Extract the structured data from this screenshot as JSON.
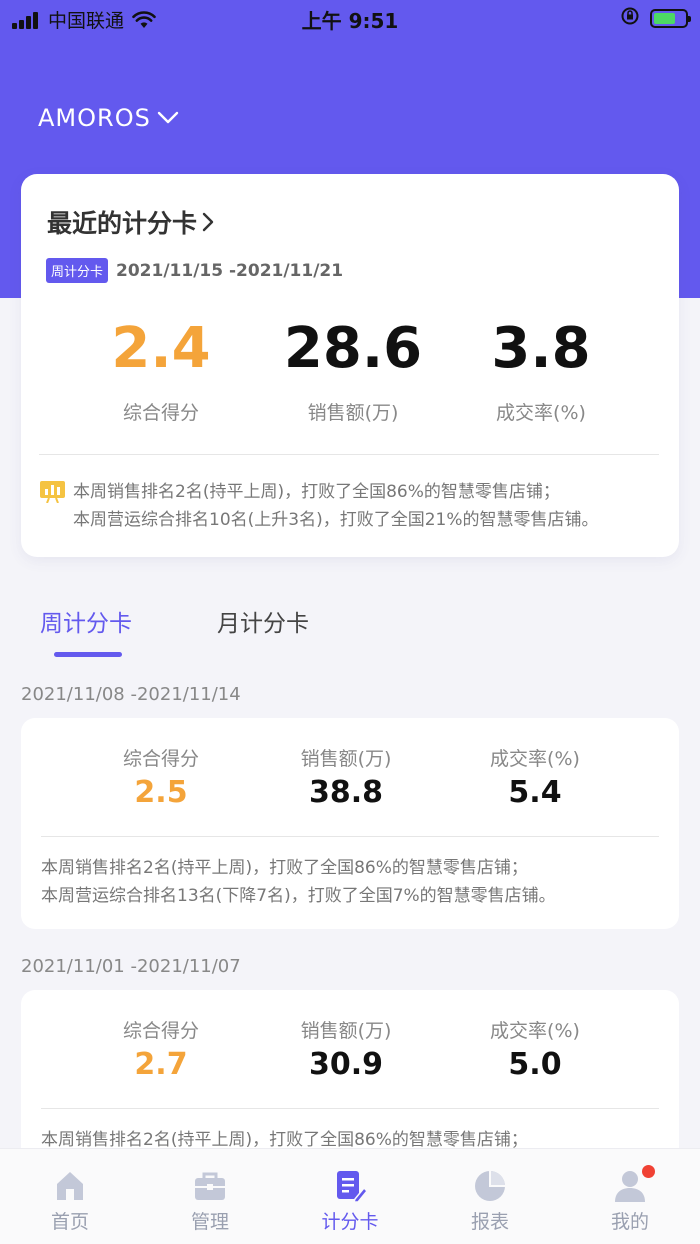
{
  "status_bar": {
    "carrier": "中国联通",
    "time": "上午 9:51"
  },
  "header": {
    "store_name": "AMOROS"
  },
  "recent_card": {
    "title": "最近的计分卡",
    "badge": "周计分卡",
    "date_range": "2021/11/15 -2021/11/21",
    "metrics": [
      {
        "value": "2.4",
        "label": "综合得分"
      },
      {
        "value": "28.6",
        "label": "销售额(万)"
      },
      {
        "value": "3.8",
        "label": "成交率(%)"
      }
    ],
    "summary": [
      "本周销售排名2名(持平上周)，打败了全国86%的智慧零售店铺；",
      "本周营运综合排名10名(上升3名)，打败了全国21%的智慧零售店铺。"
    ]
  },
  "tabs": [
    {
      "label": "周计分卡",
      "active": true
    },
    {
      "label": "月计分卡",
      "active": false
    }
  ],
  "history": [
    {
      "date_range": "2021/11/08 -2021/11/14",
      "metrics": [
        {
          "label": "综合得分",
          "value": "2.5"
        },
        {
          "label": "销售额(万)",
          "value": "38.8"
        },
        {
          "label": "成交率(%)",
          "value": "5.4"
        }
      ],
      "summary": [
        " 本周销售排名2名(持平上周)，打败了全国86%的智慧零售店铺；",
        "本周营运综合排名13名(下降7名)，打败了全国7%的智慧零售店铺。"
      ]
    },
    {
      "date_range": "2021/11/01 -2021/11/07",
      "metrics": [
        {
          "label": "综合得分",
          "value": "2.7"
        },
        {
          "label": "销售额(万)",
          "value": "30.9"
        },
        {
          "label": "成交率(%)",
          "value": "5.0"
        }
      ],
      "summary": [
        " 本周销售排名2名(持平上周)，打败了全国86%的智慧零售店铺；"
      ]
    }
  ],
  "bottom_nav": [
    {
      "label": "首页",
      "icon": "home-icon"
    },
    {
      "label": "管理",
      "icon": "briefcase-icon"
    },
    {
      "label": "计分卡",
      "icon": "scorecard-icon",
      "active": true
    },
    {
      "label": "报表",
      "icon": "pie-chart-icon"
    },
    {
      "label": "我的",
      "icon": "user-icon",
      "notification_dot": true
    }
  ],
  "colors": {
    "primary": "#6359ee",
    "score_orange": "#f4a43a",
    "notification_red": "#f04134"
  }
}
